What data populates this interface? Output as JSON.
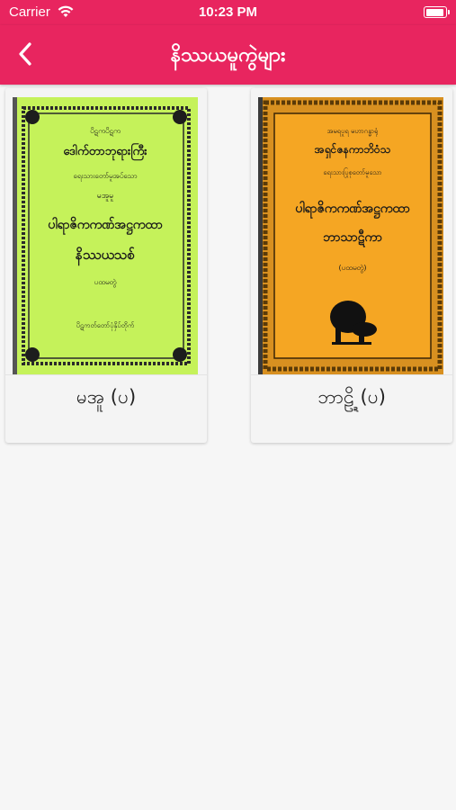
{
  "status_bar": {
    "carrier": "Carrier",
    "time": "10:23 PM",
    "wifi_icon": "wifi-icon",
    "battery_icon": "battery-icon"
  },
  "nav": {
    "title": "နိဿယမူကွဲများ",
    "back_icon": "chevron-left-icon",
    "bar_color": "#e8255f"
  },
  "books": [
    {
      "label": "မအူ (ပ)",
      "cover_bg": "#c5f25a",
      "cover_text": [
        "ပိဋကပိဋက",
        "ဒေါက်တာဘုရားကြီး",
        "ရေးသားတော်မူအပ်သော",
        "မအူမူ",
        "ပါရာဇိကကဏ်အဋ္ဌကထာ",
        "နိဿယသစ်",
        "ပထမတွဲ",
        "ပိဋကတ်တော်ပုံနှိပ်တိုက်"
      ]
    },
    {
      "label": "ဘာဠ္ဍိ (ပ)",
      "cover_bg": "#f5a623",
      "cover_text": [
        "အမရပူရ မဟာဂန္ဓာရုံ",
        "အရှင်ဇနကာဘိဝံသ",
        "ရေးသားပြုစုတော်မူသော",
        "ပါရာဇိကကဏ်အဋ္ဌကထာ",
        "ဘာသာဋီကာ",
        "(ပထမတွဲ)"
      ]
    }
  ]
}
